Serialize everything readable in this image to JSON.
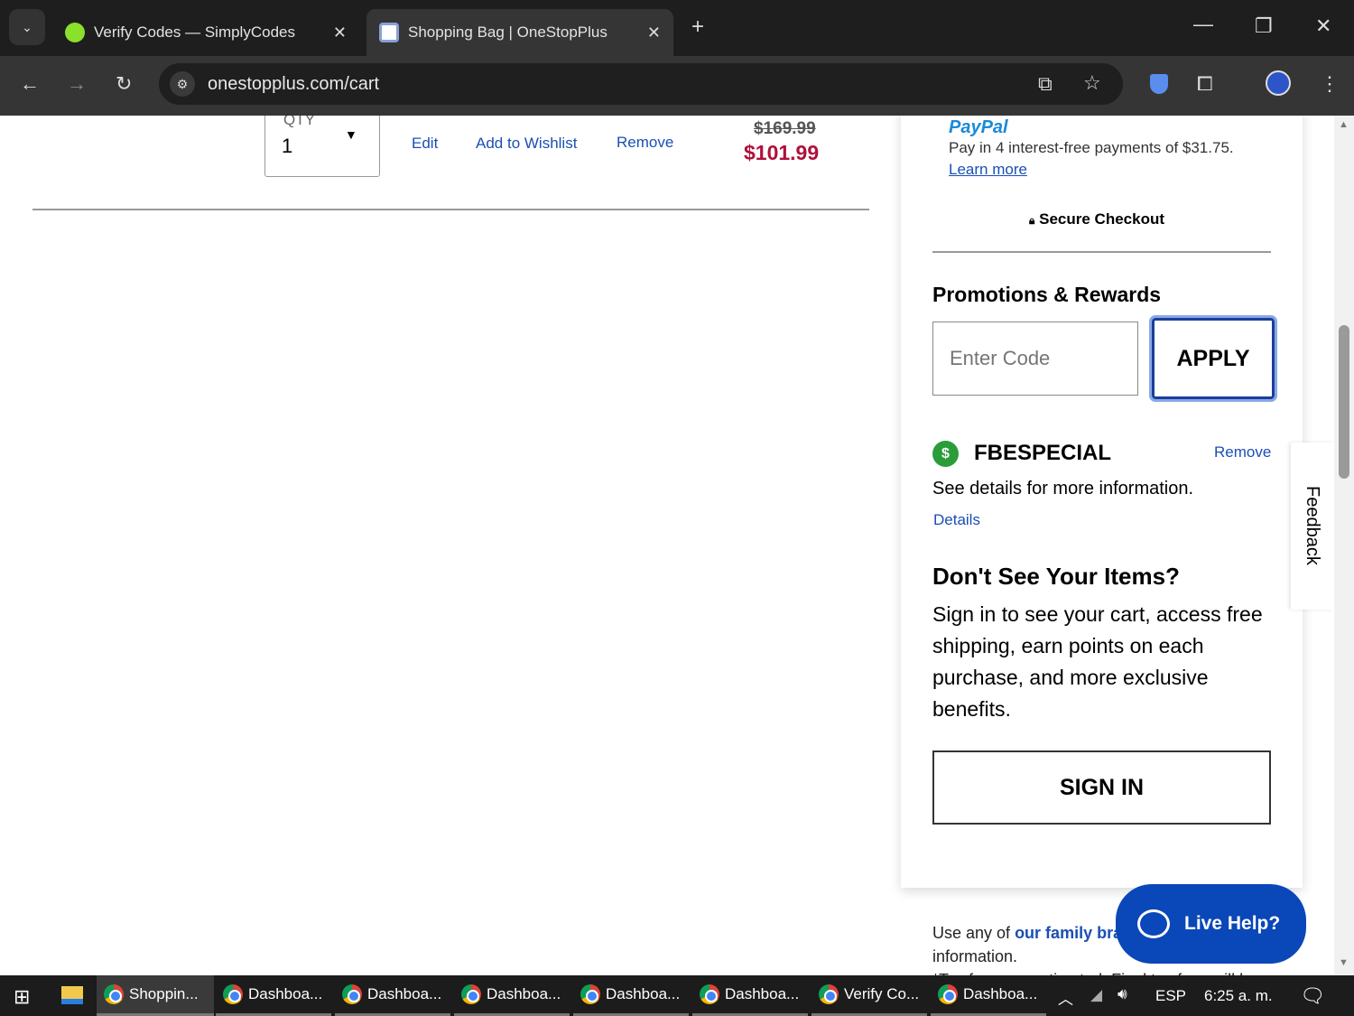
{
  "browser": {
    "tabs": [
      {
        "title": "Verify Codes — SimplyCodes"
      },
      {
        "title": "Shopping Bag | OneStopPlus"
      }
    ],
    "url": "onestopplus.com/cart"
  },
  "item": {
    "qty_label": "QTY",
    "qty_value": "1",
    "edit": "Edit",
    "wishlist": "Add to Wishlist",
    "remove": "Remove",
    "original_price": "$169.99",
    "sale_price": "$101.99"
  },
  "summary": {
    "paypal_brand": "PayPal",
    "paypal_text": "Pay in 4 interest-free payments of $31.75.",
    "learn_more": "Learn more",
    "secure_checkout": "Secure Checkout",
    "promo_heading": "Promotions & Rewards",
    "promo_placeholder": "Enter Code",
    "apply": "APPLY",
    "coupon_code": "FBESPECIAL",
    "coupon_remove": "Remove",
    "coupon_desc": "See details for more information.",
    "details": "Details",
    "signin_heading": "Don't See Your Items?",
    "signin_text": "Sign in to see your cart, access free shipping, earn points on each purchase, and more exclusive benefits.",
    "signin_button": "SIGN IN"
  },
  "footer": {
    "prefix": "Use any of",
    "family_link": "our family bra",
    "line2": "information.",
    "line3": "*Tax fees are estimated. Final tax fees will be"
  },
  "feedback": "Feedback",
  "live_help": "Live Help?",
  "taskbar": {
    "items": [
      "Shoppin...",
      "Dashboa...",
      "Dashboa...",
      "Dashboa...",
      "Dashboa...",
      "Dashboa...",
      "Verify Co...",
      "Dashboa..."
    ],
    "lang": "ESP",
    "time": "6:25 a. m."
  },
  "colors": {
    "accent": "#1a4fb4",
    "sale": "#b0103a",
    "live_help": "#0a47b8"
  }
}
